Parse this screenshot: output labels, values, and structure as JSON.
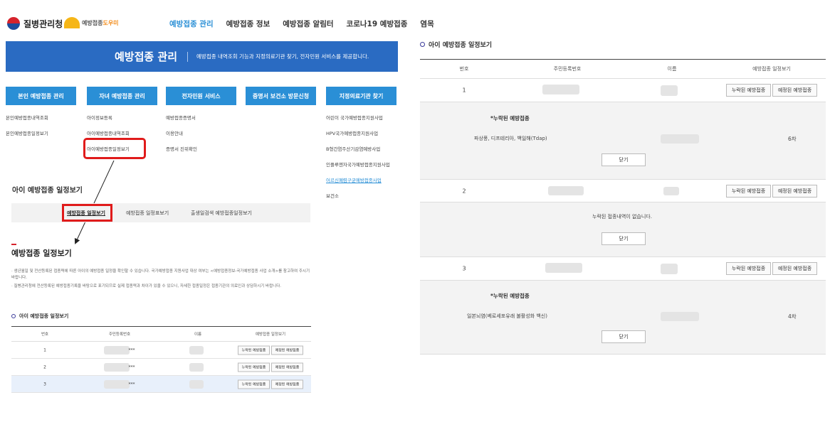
{
  "header": {
    "org_name": "질병관리청",
    "helper_logo": "예방접종도우미",
    "helper_logo_accent": "도우미",
    "nav": [
      "예방접종 관리",
      "예방접종 정보",
      "예방접종 알림터",
      "코로나19 예방접종",
      "염목"
    ]
  },
  "banner": {
    "title": "예방접종 관리",
    "desc": "예방접종 내역조회 기능과 지정의료기관 찾기, 전자민원 서비스를 제공합니다."
  },
  "menu": [
    {
      "head": "본인 예방접종 관리",
      "items": [
        "본인예방접종내역조회",
        "본인예방접종일정보기"
      ]
    },
    {
      "head": "자녀 예방접종 관리",
      "items": [
        "아이정보등록",
        "아이예방접종내역조회",
        "아이예방접종일정보기"
      ]
    },
    {
      "head": "전자민원 서비스",
      "items": [
        "예방접종증명서",
        "이용안내",
        "증명서 진위확인"
      ]
    },
    {
      "head": "증명서 보건소 방문신청",
      "items": []
    },
    {
      "head": "지정의료기관 찾기",
      "items": [
        "어린이 국가예방접종지원사업",
        "HPV국가예방접종지원사업",
        "B형간염주산기감염예방사업",
        "인플루엔자국가예방접종지원사업",
        "어르신폐렴구균예방접종사업",
        "보건소"
      ]
    }
  ],
  "section": {
    "title": "아이 예방접종 일정보기",
    "tabs": [
      "예방접종 일정보기",
      "예방접종 일정표보기",
      "출생일검색 예방접종일정보기"
    ],
    "page_title": "예방접종 일정보기",
    "notes": [
      "· 생년월일 및 전산등록된 접종력에 따른 아이의 예방접종 일정을 확인할 수 있습니다. 국가예방접종 지원사업 대상 여부는 <예방접종정보-국가예방접종 사업 소개>를 참고하여 주시기 바랍니다.",
      "· 질병관리청에 전산등록된 예방접종기록을 바탕으로 표기되므로 실제 접종력과 차이가 있을 수 있으니, 자세한 접종일정은 접종기관의 의료인과 상담하시기 바랍니다."
    ],
    "table_title": "아이 예방접종 일정보기"
  },
  "table": {
    "headers": [
      "번호",
      "주민등록번호",
      "이름",
      "예방접종 일정보기"
    ],
    "missed_label": "누락된 예방접종",
    "scheduled_label": "예정된 예방접종",
    "rows": [
      {
        "no": "1",
        "rrn_suffix": "***"
      },
      {
        "no": "2",
        "rrn_suffix": "***"
      },
      {
        "no": "3",
        "rrn_suffix": "***"
      }
    ]
  },
  "right": {
    "title": "아이 예방접종 일정보기",
    "detail_label": "*누락된 예방접종",
    "close_label": "닫기",
    "details": [
      {
        "vaccine": "파상풍, 디프테리아, 백일해(Tdap)",
        "dose": "6차"
      },
      {
        "message": "누락된 접종내역이 없습니다."
      },
      {
        "vaccine": "일본뇌염(베로세포유래 불활성화 백신)",
        "dose": "4차"
      }
    ]
  },
  "colors": {
    "primary_blue": "#2a8fd6",
    "banner_blue": "#2a6bc2",
    "highlight_red": "#e01b1b"
  },
  "icons": [
    "taeguk-logo-icon",
    "sun-logo-icon",
    "circle-bullet-icon",
    "arrow-icon"
  ]
}
